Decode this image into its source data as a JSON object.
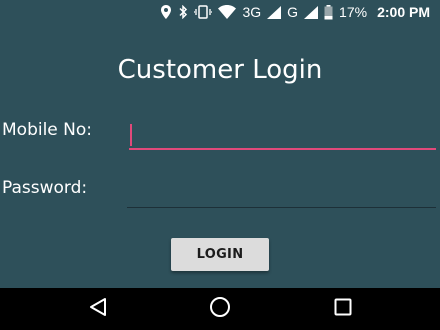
{
  "status_bar": {
    "network_3g": "3G",
    "network_g": "G",
    "battery_percent": "17%",
    "time": "2:00 PM",
    "icons": [
      "location-icon",
      "bluetooth-icon",
      "vibrate-icon",
      "wifi-icon",
      "signal-icon",
      "battery-icon"
    ]
  },
  "page": {
    "title": "Customer Login"
  },
  "form": {
    "mobile_label": "Mobile No:",
    "mobile_value": "",
    "password_label": "Password:",
    "password_value": "",
    "login_label": "LOGIN"
  },
  "nav_bar": {
    "icons": [
      "back-icon",
      "home-icon",
      "recent-apps-icon"
    ]
  },
  "colors": {
    "background": "#2e505a",
    "accent": "#e0497a",
    "button": "#dcdcdc",
    "nav_bar": "#000000"
  }
}
